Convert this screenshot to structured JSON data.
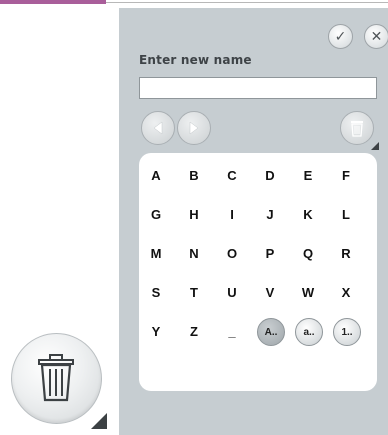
{
  "dialog": {
    "label": "Enter new name",
    "input_value": "",
    "input_placeholder": "",
    "confirm_icon": "✓",
    "close_icon": "✕"
  },
  "keyboard": {
    "rows": [
      [
        "A",
        "B",
        "C",
        "D",
        "E",
        "F"
      ],
      [
        "G",
        "H",
        "I",
        "J",
        "K",
        "L"
      ],
      [
        "M",
        "N",
        "O",
        "P",
        "Q",
        "R"
      ],
      [
        "S",
        "T",
        "U",
        "V",
        "W",
        "X"
      ],
      [
        "Y",
        "Z",
        "_"
      ]
    ],
    "modes": [
      "A..",
      "a..",
      "1.."
    ],
    "active_mode": "A.."
  }
}
